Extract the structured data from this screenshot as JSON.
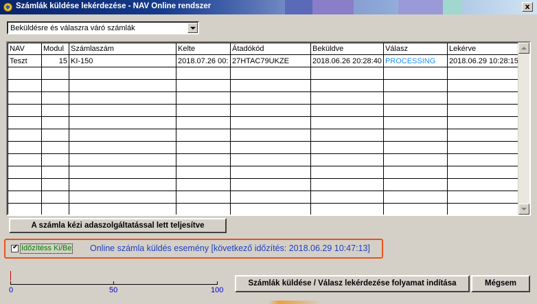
{
  "window": {
    "title": "Számlák küldése lekérdezése - NAV Online rendszer",
    "close_glyph": "x"
  },
  "filter": {
    "selected": "Beküldésre és válaszra váró számlák"
  },
  "table": {
    "columns": [
      "NAV",
      "Modul",
      "Számlaszám",
      "Kelte",
      "Átadókód",
      "Beküldve",
      "Válasz",
      "Lekérve"
    ],
    "rows": [
      [
        "Teszt",
        "15",
        "KI-150",
        "2018.07.26 00:",
        "27HTAC79UKZE",
        "2018.06.26 20:28:40",
        "PROCESSING",
        "2018.06.29 10:28:15"
      ]
    ],
    "empty_rows": 12
  },
  "buttons": {
    "manual": "A számla kézi adaszolgáltatással lett teljesítve",
    "start": "Számlák küldése / Válasz lekérdezése folyamat indítása",
    "cancel": "Mégsem"
  },
  "timer": {
    "checkbox_label": "Időzítéss Ki/Be",
    "checked": true,
    "event_text": "Online számla küldés esemény [következő időzítés: 2018.06.29 10:47:13]"
  },
  "progress": {
    "value": 0,
    "ticks": [
      "0",
      "50",
      "100"
    ]
  },
  "colors": {
    "processing": "#1e90ff",
    "highlight_border": "#e8521a",
    "event_text": "#1f3fbf",
    "checkbox_label": "#008000"
  }
}
